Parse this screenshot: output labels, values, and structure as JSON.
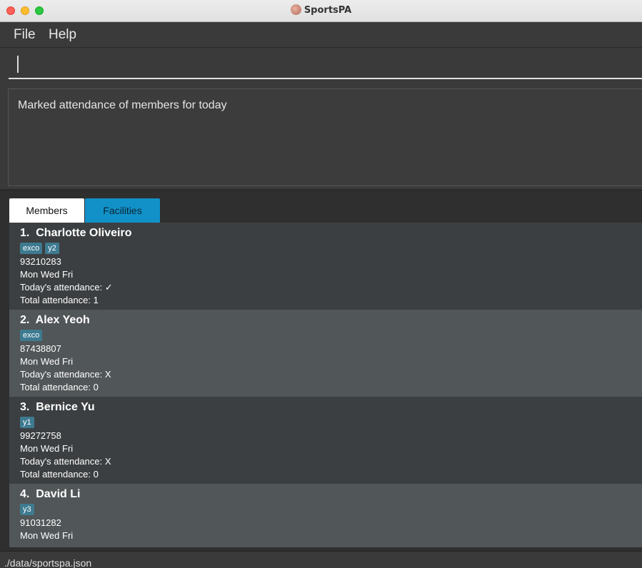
{
  "window": {
    "title": "SportsPA"
  },
  "menu": {
    "file": "File",
    "help": "Help"
  },
  "command": {
    "value": "",
    "placeholder": ""
  },
  "result": {
    "message": "Marked attendance of members for today"
  },
  "tabs": {
    "members": "Members",
    "facilities": "Facilities"
  },
  "members": [
    {
      "index": "1.",
      "name": "Charlotte Oliveiro",
      "tags": [
        "exco",
        "y2"
      ],
      "phone": "93210283",
      "days": "Mon Wed Fri",
      "today": "Today's attendance: ✓",
      "total": "Total attendance: 1"
    },
    {
      "index": "2.",
      "name": "Alex Yeoh",
      "tags": [
        "exco"
      ],
      "phone": "87438807",
      "days": "Mon Wed Fri",
      "today": "Today's attendance: X",
      "total": "Total attendance: 0"
    },
    {
      "index": "3.",
      "name": "Bernice Yu",
      "tags": [
        "y1"
      ],
      "phone": "99272758",
      "days": "Mon Wed Fri",
      "today": "Today's attendance: X",
      "total": "Total attendance: 0"
    },
    {
      "index": "4.",
      "name": "David Li",
      "tags": [
        "y3"
      ],
      "phone": "91031282",
      "days": "Mon Wed Fri",
      "today": "",
      "total": ""
    }
  ],
  "status": {
    "path": "./data/sportspa.json"
  }
}
